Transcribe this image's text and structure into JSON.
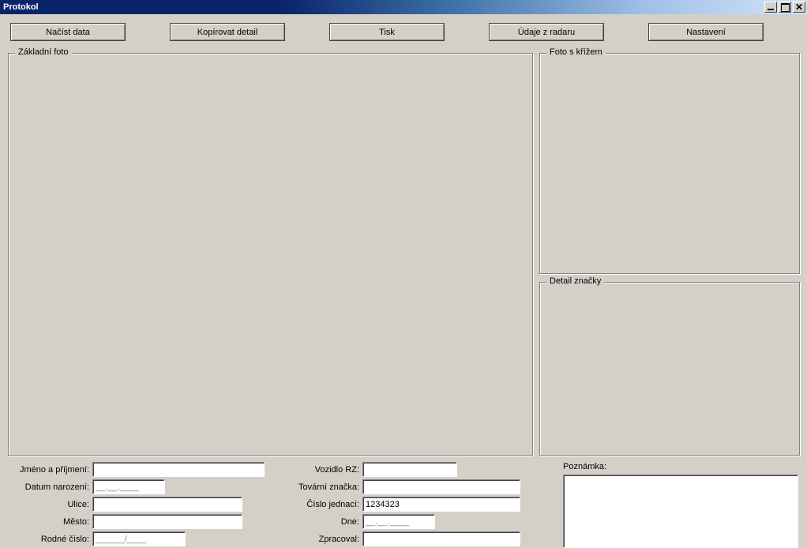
{
  "window": {
    "title": "Protokol"
  },
  "toolbar": {
    "load": "Načíst data",
    "copy_detail": "Kopírovat detail",
    "print": "Tisk",
    "radar_data": "Údaje z radaru",
    "settings": "Nastavení"
  },
  "groups": {
    "basic_photo": "Základní foto",
    "cross_photo": "Foto s křížem",
    "plate_detail": "Detail značky"
  },
  "labels": {
    "name": "Jméno a příjmení:",
    "birth_date": "Datum narození:",
    "street": "Ulice:",
    "city": "Město:",
    "birth_number": "Rodné číslo:",
    "vehicle_plate": "Vozidlo RZ:",
    "make": "Tovární značka:",
    "case_no": "Číslo jednací:",
    "date": "Dne:",
    "processed_by": "Zpracoval:",
    "note": "Poznámka:"
  },
  "values": {
    "name": "",
    "birth_date_mask": "__.__.____",
    "street": "",
    "city": "",
    "birth_number_mask": "______/____",
    "vehicle_plate": "",
    "make": "",
    "case_no": "1234323",
    "date_mask": "__.__.____",
    "processed_by": "",
    "note": ""
  }
}
